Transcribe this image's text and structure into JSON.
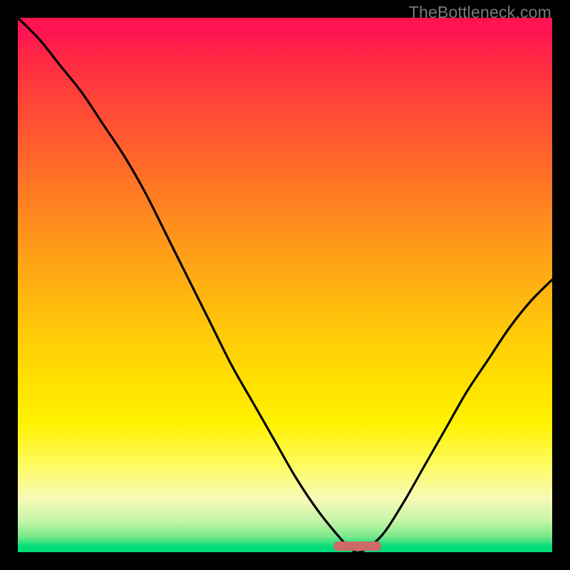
{
  "watermark": "TheBottleneck.com",
  "chart_data": {
    "type": "line",
    "title": "",
    "xlabel": "",
    "ylabel": "",
    "xlim": [
      0,
      100
    ],
    "ylim": [
      0,
      100
    ],
    "series": [
      {
        "name": "bottleneck-curve",
        "x": [
          0,
          4,
          8,
          12,
          16,
          20,
          24,
          28,
          32,
          36,
          40,
          44,
          48,
          52,
          56,
          60,
          62,
          64,
          68,
          72,
          76,
          80,
          84,
          88,
          92,
          96,
          100
        ],
        "values": [
          100,
          96,
          91,
          86,
          80,
          74,
          67,
          59,
          51,
          43,
          35,
          28,
          21,
          14,
          8,
          3,
          1,
          0,
          3,
          9,
          16,
          23,
          30,
          36,
          42,
          47,
          51
        ]
      }
    ],
    "marker": {
      "x_start": 59,
      "x_end": 68,
      "y": 1.2
    },
    "gradient_stops": [
      {
        "pos": 0,
        "color": "#ff1452"
      },
      {
        "pos": 50,
        "color": "#ffc400"
      },
      {
        "pos": 85,
        "color": "#fff86e"
      },
      {
        "pos": 100,
        "color": "#00d878"
      }
    ]
  }
}
